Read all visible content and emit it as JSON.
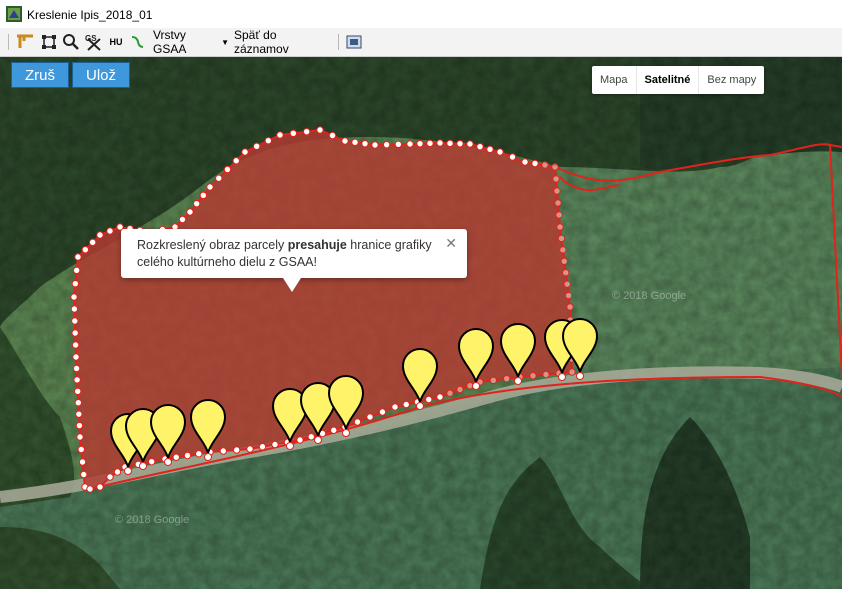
{
  "window": {
    "title": "Kreslenie Ipis_2018_01"
  },
  "toolbar": {
    "layers_label": "Vrstvy GSAA",
    "back_label": "Späť do záznamov",
    "hu_label": "HU",
    "gs_label": "GS"
  },
  "map": {
    "cancel_label": "Zruš",
    "save_label": "Ulož",
    "map_types": [
      "Mapa",
      "Satelitné",
      "Bez mapy"
    ],
    "active_map_type": "Satelitné",
    "copyright_1": "© 2018 Google",
    "copyright_2": "© 2018 Google",
    "colors": {
      "parcel_fill": "#b53a32",
      "parcel_line": "#e0231c",
      "marker": "#fff36a",
      "button": "#3f97dc"
    }
  },
  "info_window": {
    "text_before": "Rozkreslený obraz parcely ",
    "text_bold": "presahuje",
    "text_after": " hranice grafiky celého kultúrneho dielu z GSAA!",
    "close_symbol": "✕"
  }
}
